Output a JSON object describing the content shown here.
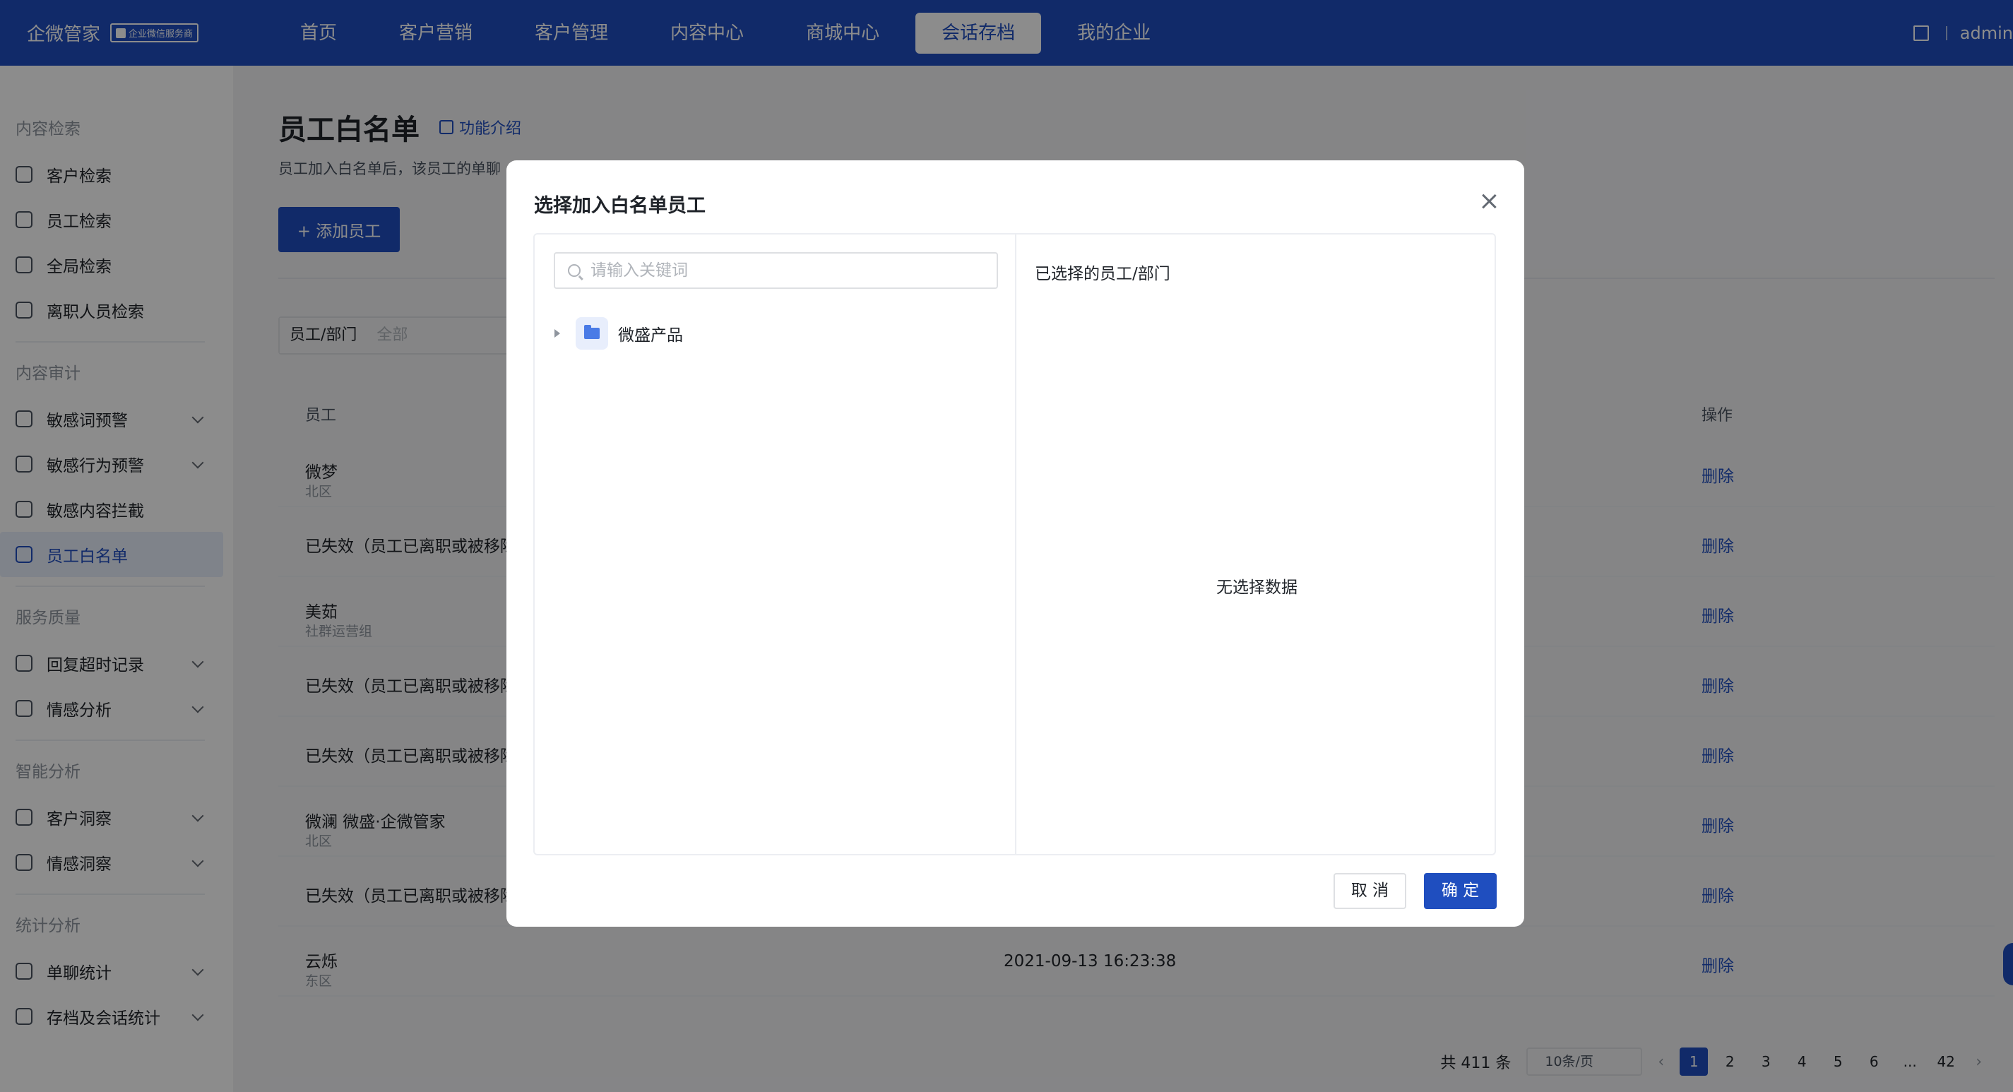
{
  "brand": {
    "name": "企微管家",
    "badge": "企业微信服务商"
  },
  "nav": {
    "items": [
      "首页",
      "客户营销",
      "客户管理",
      "内容中心",
      "商城中心",
      "会话存档",
      "我的企业"
    ],
    "active": "会话存档"
  },
  "user": {
    "name": "admin"
  },
  "sidebar": {
    "groups": [
      {
        "title": "内容检索",
        "items": [
          {
            "label": "客户检索",
            "icon": "scan-user-icon",
            "expandable": false
          },
          {
            "label": "员工检索",
            "icon": "scan-user-icon",
            "expandable": false
          },
          {
            "label": "全局检索",
            "icon": "scan-search-icon",
            "expandable": false
          },
          {
            "label": "离职人员检索",
            "icon": "user-icon",
            "expandable": false
          }
        ]
      },
      {
        "title": "内容审计",
        "items": [
          {
            "label": "敏感词预警",
            "icon": "doc-warning-icon",
            "expandable": true
          },
          {
            "label": "敏感行为预警",
            "icon": "shield-alert-icon",
            "expandable": true
          },
          {
            "label": "敏感内容拦截",
            "icon": "doc-block-icon",
            "expandable": false
          },
          {
            "label": "员工白名单",
            "icon": "checklist-icon",
            "expandable": false,
            "active": true
          }
        ]
      },
      {
        "title": "服务质量",
        "items": [
          {
            "label": "回复超时记录",
            "icon": "alarm-icon",
            "expandable": true
          },
          {
            "label": "情感分析",
            "icon": "heart-pulse-icon",
            "expandable": true
          }
        ]
      },
      {
        "title": "智能分析",
        "items": [
          {
            "label": "客户洞察",
            "icon": "users-icon",
            "expandable": true
          },
          {
            "label": "情感洞察",
            "icon": "heart-pulse-icon",
            "expandable": true
          }
        ]
      },
      {
        "title": "统计分析",
        "items": [
          {
            "label": "单聊统计",
            "icon": "pie-chart-icon",
            "expandable": true
          },
          {
            "label": "存档及会话统计",
            "icon": "list-doc-icon",
            "expandable": true
          }
        ]
      }
    ]
  },
  "page": {
    "title": "员工白名单",
    "intro_link": "功能介绍",
    "description": "员工加入白名单后，该员工的单聊",
    "add_button": "+ 添加员工",
    "filter": {
      "label": "员工/部门",
      "value": "全部"
    }
  },
  "table": {
    "headers": {
      "employee": "员工",
      "action": "操作"
    },
    "rows": [
      {
        "name": "微梦",
        "sub": "北区",
        "time": "",
        "action": "删除"
      },
      {
        "name": "已失效（员工已离职或被移除",
        "sub": "",
        "time": "",
        "action": "删除"
      },
      {
        "name": "美茹",
        "sub": "社群运营组",
        "time": "",
        "action": "删除"
      },
      {
        "name": "已失效（员工已离职或被移除",
        "sub": "",
        "time": "",
        "action": "删除"
      },
      {
        "name": "已失效（员工已离职或被移除",
        "sub": "",
        "time": "",
        "action": "删除"
      },
      {
        "name": "微澜 微盛·企微管家",
        "sub": "北区",
        "time": "",
        "action": "删除"
      },
      {
        "name": "已失效（员工已离职或被移除",
        "sub": "",
        "time": "",
        "action": "删除"
      },
      {
        "name": "云烁",
        "sub": "东区",
        "time": "2021-09-13 16:23:38",
        "action": "删除"
      }
    ]
  },
  "pagination": {
    "total": "共 411 条",
    "page_size": "10条/页",
    "prev": "‹",
    "next": "›",
    "pages": [
      "1",
      "2",
      "3",
      "4",
      "5",
      "6",
      "...",
      "42"
    ],
    "active": "1"
  },
  "modal": {
    "title": "选择加入白名单员工",
    "search_placeholder": "请输入关键词",
    "tree": [
      {
        "label": "微盛产品"
      }
    ],
    "selected_title": "已选择的员工/部门",
    "empty_text": "无选择数据",
    "cancel": "取 消",
    "confirm": "确 定"
  },
  "colors": {
    "primary": "#1f4ebf",
    "mask": "rgba(0,0,0,0.45)"
  }
}
